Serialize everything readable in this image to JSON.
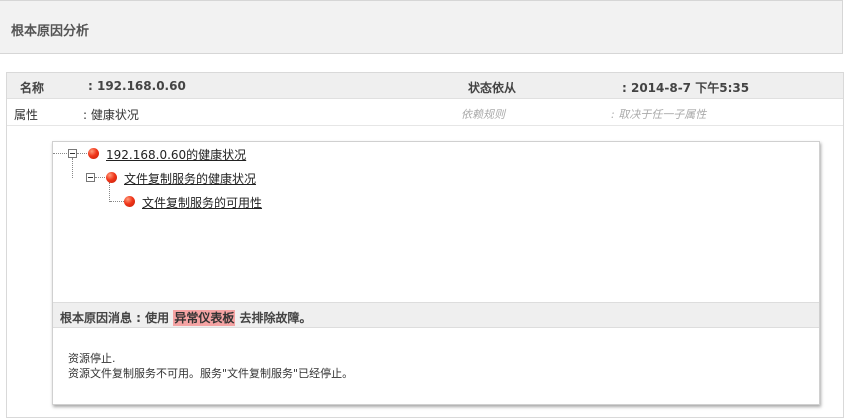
{
  "header": {
    "title": "根本原因分析"
  },
  "properties": {
    "name_label": "名称",
    "name_value": ": 192.168.0.60",
    "status_dependency_label": "状态依从",
    "status_dependency_value": ": 2014-8-7 下午5:35",
    "attribute_label": "属性",
    "attribute_value": ": 健康状况",
    "dependency_rule_label": "依赖规则",
    "dependency_rule_value": ": 取决于任一子属性"
  },
  "tree": {
    "nodes": [
      {
        "label": "192.168.0.60的健康状况",
        "status": "critical",
        "expanded": true
      },
      {
        "label": "文件复制服务的健康状况",
        "status": "critical",
        "expanded": true
      },
      {
        "label": "文件复制服务的可用性",
        "status": "critical"
      }
    ]
  },
  "message": {
    "prefix": "根本原因消息 : 使用 ",
    "link": "异常仪表板",
    "suffix": " 去排除故障。",
    "lines": [
      "资源停止.",
      "资源文件复制服务不可用。服务\"文件复制服务\"已经停止。"
    ]
  },
  "colors": {
    "status_critical": "#f0361a",
    "highlight": "#f5a3a3"
  }
}
